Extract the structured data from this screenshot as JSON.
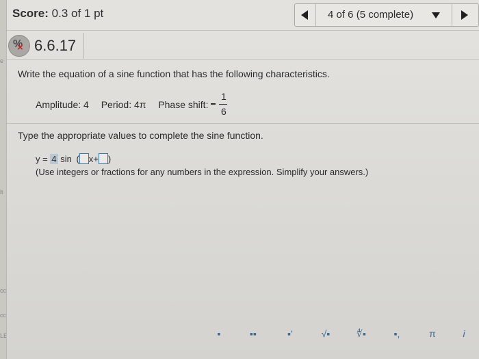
{
  "score": {
    "label": "Score:",
    "value": "0.3 of 1 pt"
  },
  "navigation": {
    "position_label": "4 of 6 (5 complete)"
  },
  "problem": {
    "number": "6.6.17",
    "status_icon": "partial-wrong-icon",
    "instructions": "Write the equation of a sine function that has the following characteristics.",
    "amplitude_label": "Amplitude: 4",
    "period_label": "Period: 4π",
    "phase_shift_label": "Phase shift:",
    "phase_shift_numerator": "1",
    "phase_shift_denominator": "6",
    "type_instruction": "Type the appropriate values to complete the sine function.",
    "equation": {
      "prefix": "y =",
      "amplitude_value": "4",
      "function_name": "sin",
      "box1_value": "",
      "variable": "x",
      "plus": "+",
      "box2_value": ""
    },
    "hint": "(Use integers or fractions for any numbers in the expression. Simplify your answers.)"
  },
  "palette": {
    "buttons": [
      {
        "name": "fraction-button",
        "glyph": "▪"
      },
      {
        "name": "mixed-number-button",
        "glyph": "▪▪"
      },
      {
        "name": "exponent-button",
        "glyph": "▪'"
      },
      {
        "name": "sqrt-button",
        "glyph": "√▪"
      },
      {
        "name": "nth-root-button",
        "glyph": "∜▪"
      },
      {
        "name": "subscript-button",
        "glyph": "▪,"
      },
      {
        "name": "pi-button",
        "glyph": "π"
      },
      {
        "name": "imaginary-i-button",
        "glyph": "i"
      }
    ]
  },
  "edge_fragments": [
    "e",
    "lt",
    "cc",
    "cc",
    "LE"
  ]
}
